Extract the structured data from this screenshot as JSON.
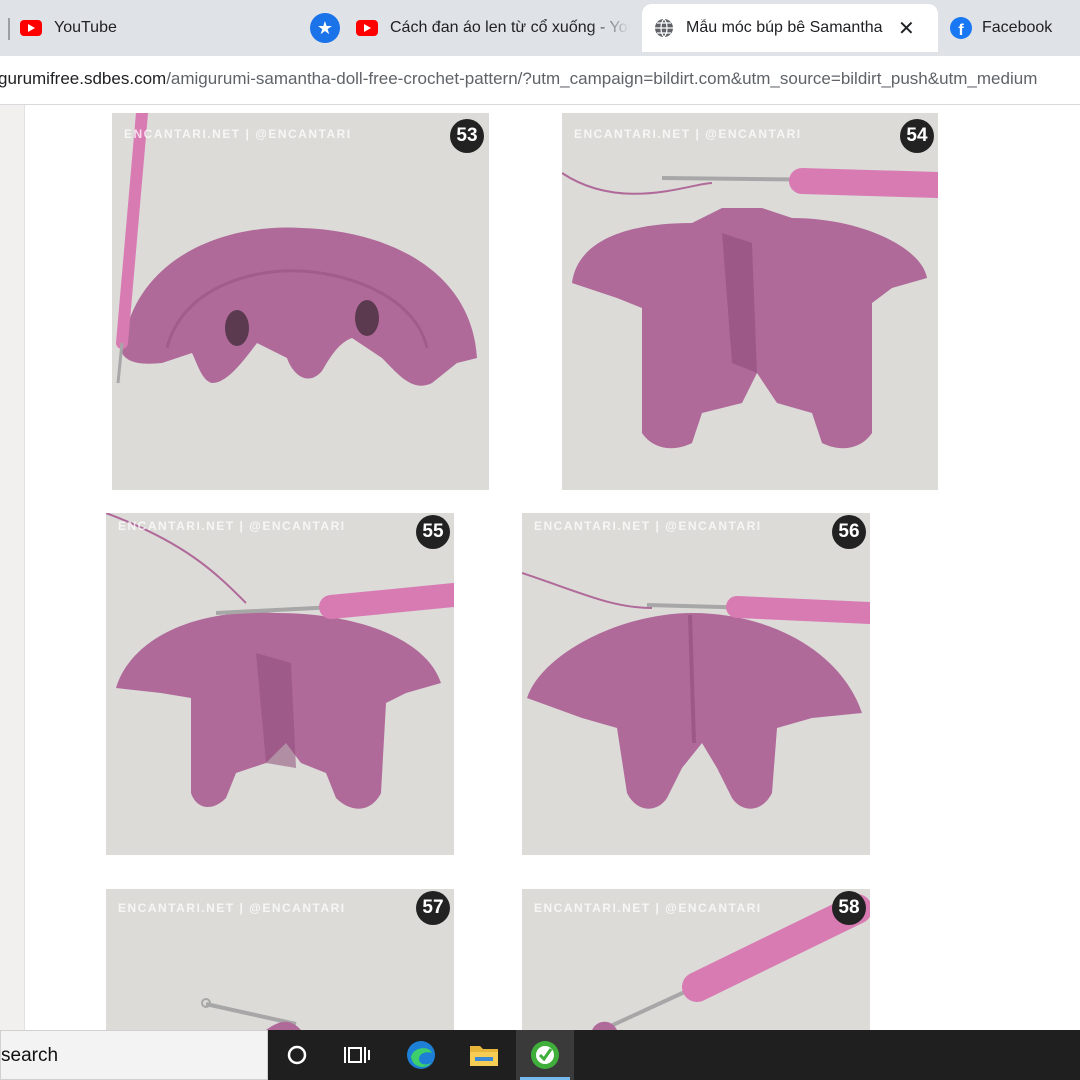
{
  "tabs": [
    {
      "label": "YouTube",
      "icon": "youtube-icon"
    },
    {
      "label": "Cách đan áo len từ cổ xuống - You",
      "icon": "youtube-icon",
      "pinned_icon": "star-icon"
    },
    {
      "label": "Mẫu móc búp bê Samantha A",
      "icon": "globe-icon",
      "active": true
    },
    {
      "label": "Facebook",
      "icon": "facebook-icon"
    }
  ],
  "address": {
    "url_host": "gurumifree.sdbes.com",
    "url_path": "/amigurumi-samantha-doll-free-crochet-pattern/?utm_campaign=bildirt.com&utm_source=bildirt_push&utm_medium"
  },
  "photos": [
    {
      "number": "53",
      "watermark": "ENCANTARI.NET | @ENCANTARI"
    },
    {
      "number": "54",
      "watermark": "ENCANTARI.NET | @ENCANTARI"
    },
    {
      "number": "55",
      "watermark": "ENCANTARI.NET | @ENCANTARI"
    },
    {
      "number": "56",
      "watermark": "ENCANTARI.NET | @ENCANTARI"
    },
    {
      "number": "57",
      "watermark": "ENCANTARI.NET | @ENCANTARI"
    },
    {
      "number": "58",
      "watermark": "ENCANTARI.NET | @ENCANTARI"
    }
  ],
  "taskbar": {
    "search_text": "search",
    "items": [
      "cortana-icon",
      "task-view-icon",
      "edge-icon",
      "file-explorer-icon",
      "app-icon"
    ]
  },
  "colors": {
    "yarn": "#b06a9a",
    "hook_handle": "#d97bb3",
    "photo_bg": "#d9d9d6"
  }
}
